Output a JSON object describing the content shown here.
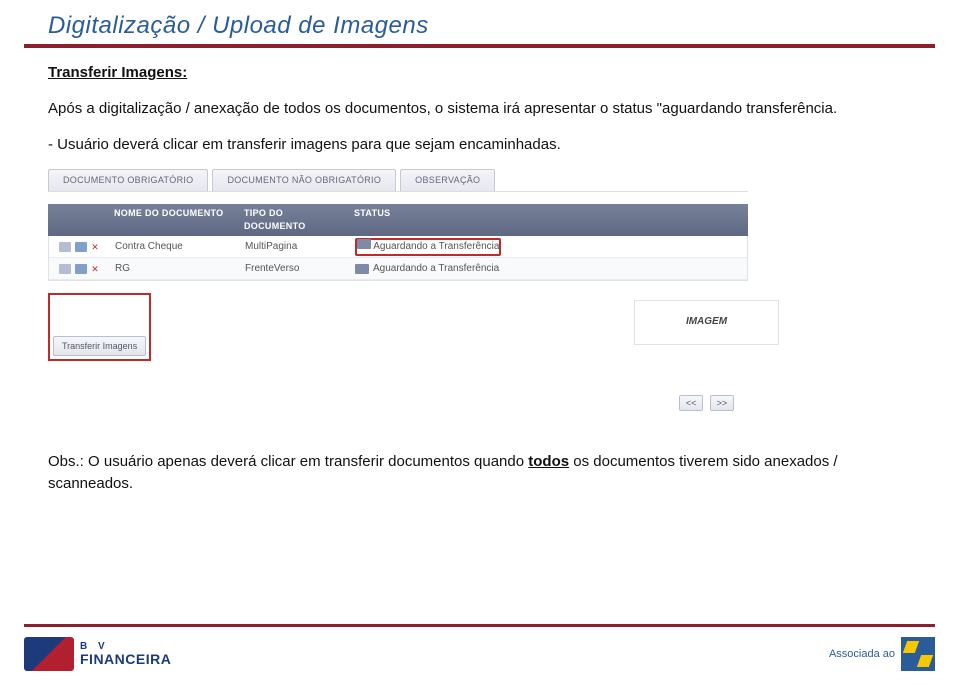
{
  "title": "Digitalização / Upload de Imagens",
  "subheading": "Transferir Imagens:",
  "para1": "Após a digitalização / anexação de todos os documentos, o sistema irá apresentar o status \"aguardando transferência.",
  "para2": "- Usuário deverá clicar em transferir imagens para que sejam encaminhadas.",
  "tabs": {
    "obrig": "DOCUMENTO OBRIGATÓRIO",
    "naoObrig": "DOCUMENTO NÃO OBRIGATÓRIO",
    "obs": "OBSERVAÇÃO"
  },
  "cols": {
    "name": "NOME DO DOCUMENTO",
    "type": "TIPO DO DOCUMENTO",
    "status": "STATUS"
  },
  "rows": [
    {
      "name": "Contra Cheque",
      "type": "MultiPagina",
      "status": "Aguardando a Transferência"
    },
    {
      "name": "RG",
      "type": "FrenteVerso",
      "status": "Aguardando a Transferência"
    }
  ],
  "transferBtn": "Transferir Imagens",
  "imagePanelLabel": "IMAGEM",
  "nav": {
    "prev": "<<",
    "next": ">>"
  },
  "obsPrefix": "Obs.: O usuário apenas deverá clicar em transferir documentos quando ",
  "obsBold": "todos",
  "obsSuffix": "  os documentos tiverem sido anexados / scanneados.",
  "footer": {
    "bv1": "B V",
    "bv2": "FINANCEIRA",
    "assoc": "Associada ao"
  }
}
